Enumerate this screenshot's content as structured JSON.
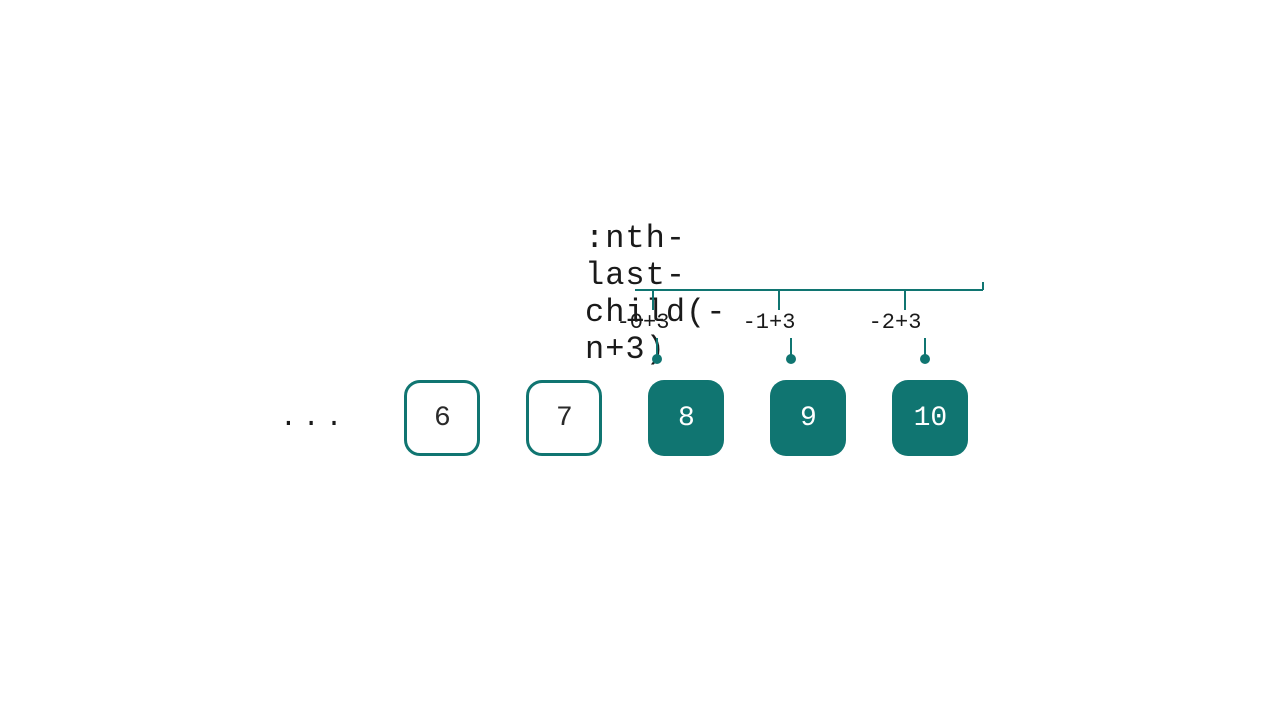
{
  "selector": ":nth-last-child(-n+3)",
  "formulas": [
    "-0+3",
    "-1+3",
    "-2+3"
  ],
  "ellipsis": "...",
  "boxes": [
    {
      "label": "6",
      "filled": false
    },
    {
      "label": "7",
      "filled": false
    },
    {
      "label": "8",
      "filled": true
    },
    {
      "label": "9",
      "filled": true
    },
    {
      "label": "10",
      "filled": true
    }
  ],
  "colors": {
    "teal": "#107571",
    "text": "#1a1a1a"
  }
}
